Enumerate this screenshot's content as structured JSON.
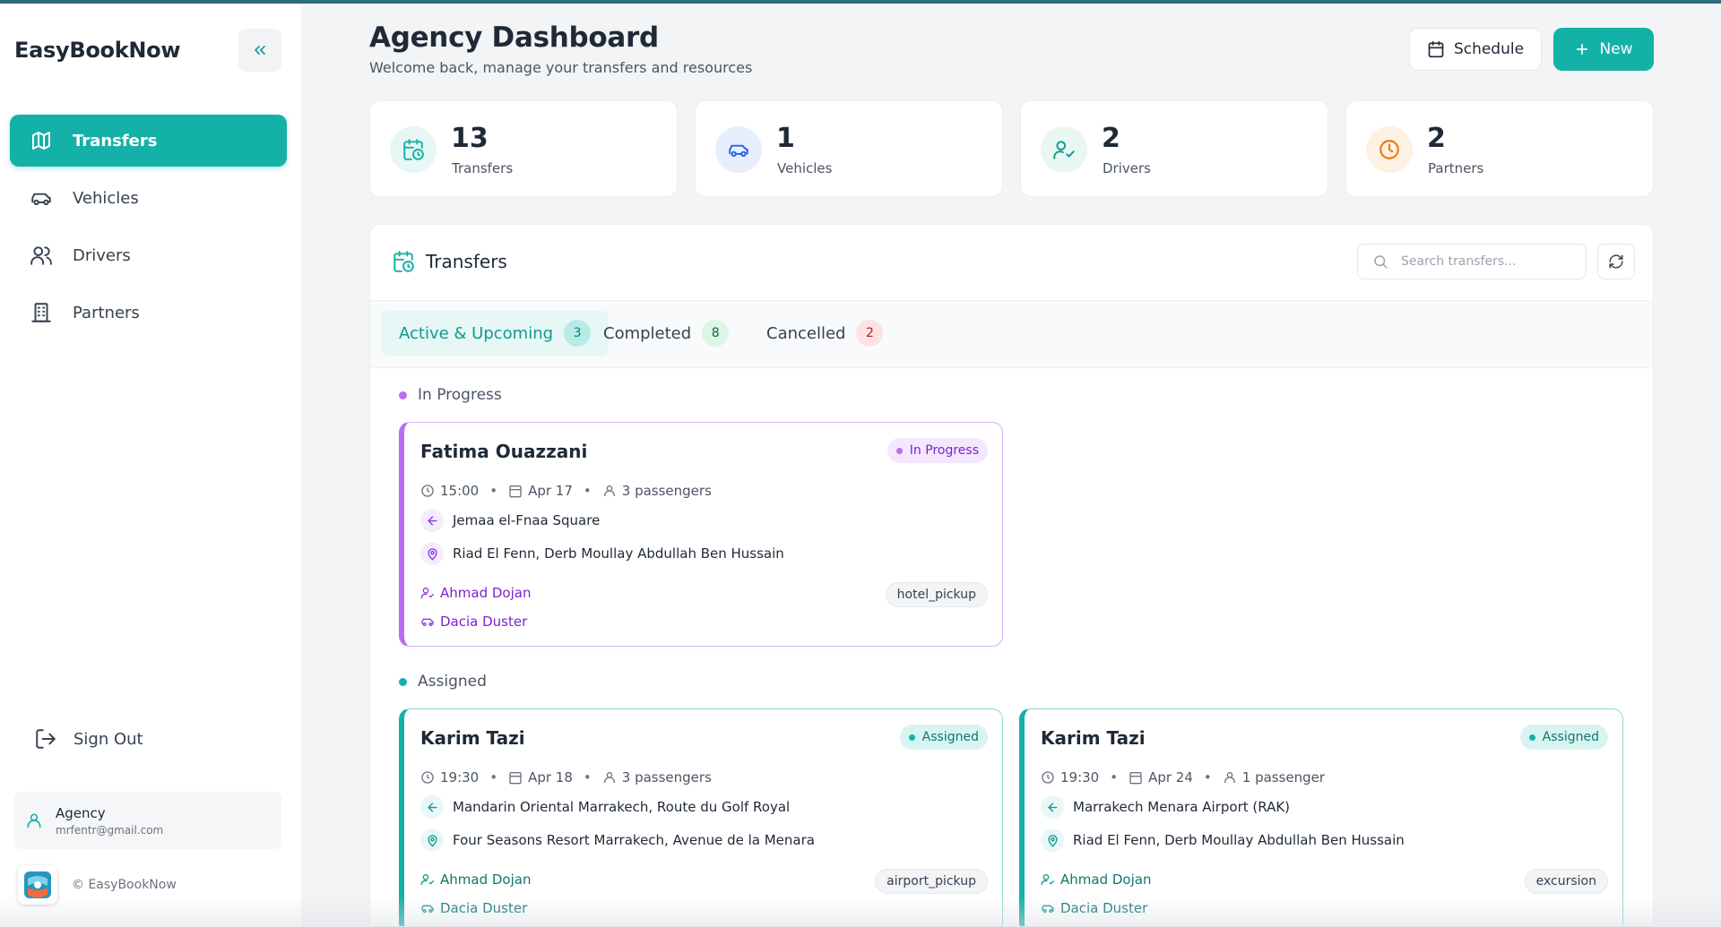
{
  "app": {
    "brand": "EasyBookNow"
  },
  "colors": {
    "accent": "#14b1a8",
    "purple": "#9333ea",
    "teal_border": "#5ccfc6",
    "purple_border": "#c98df5",
    "danger": "#dc2626"
  },
  "sidebar": {
    "items": [
      {
        "label": "Transfers",
        "icon": "map-icon",
        "active": true
      },
      {
        "label": "Vehicles",
        "icon": "car-icon",
        "active": false
      },
      {
        "label": "Drivers",
        "icon": "users-icon",
        "active": false
      },
      {
        "label": "Partners",
        "icon": "building-icon",
        "active": false
      }
    ],
    "sign_out": "Sign Out",
    "user": {
      "name": "Agency",
      "email": "mrfentr@gmail.com"
    },
    "copyright": "© EasyBookNow"
  },
  "header": {
    "title": "Agency Dashboard",
    "subtitle": "Welcome back, manage your transfers and resources",
    "schedule_label": "Schedule",
    "new_label": "New"
  },
  "stats": [
    {
      "value": "13",
      "label": "Transfers",
      "icon": "calendar-clock-icon"
    },
    {
      "value": "1",
      "label": "Vehicles",
      "icon": "car-icon"
    },
    {
      "value": "2",
      "label": "Drivers",
      "icon": "user-check-icon"
    },
    {
      "value": "2",
      "label": "Partners",
      "icon": "clock-icon"
    }
  ],
  "panel": {
    "title": "Transfers",
    "search_placeholder": "Search transfers...",
    "tabs": [
      {
        "label": "Active & Upcoming",
        "count": "3"
      },
      {
        "label": "Completed",
        "count": "8"
      },
      {
        "label": "Cancelled",
        "count": "2"
      }
    ],
    "sections": [
      {
        "label": "In Progress"
      },
      {
        "label": "Assigned"
      }
    ],
    "cards": [
      {
        "name": "Fatima Ouazzani",
        "status": "In Progress",
        "time": "15:00",
        "date": "Apr 17",
        "passengers": "3 passengers",
        "from": "Jemaa el-Fnaa Square",
        "to": "Riad El Fenn, Derb Moullay Abdullah Ben Hussain",
        "driver": "Ahmad Dojan",
        "vehicle": "Dacia Duster",
        "type": "hotel_pickup"
      },
      {
        "name": "Karim Tazi",
        "status": "Assigned",
        "time": "19:30",
        "date": "Apr 18",
        "passengers": "3 passengers",
        "from": "Mandarin Oriental Marrakech, Route du Golf Royal",
        "to": "Four Seasons Resort Marrakech, Avenue de la Menara",
        "driver": "Ahmad Dojan",
        "vehicle": "Dacia Duster",
        "type": "airport_pickup"
      },
      {
        "name": "Karim Tazi",
        "status": "Assigned",
        "time": "19:30",
        "date": "Apr 24",
        "passengers": "1 passenger",
        "from": "Marrakech Menara Airport (RAK)",
        "to": "Riad El Fenn, Derb Moullay Abdullah Ben Hussain",
        "driver": "Ahmad Dojan",
        "vehicle": "Dacia Duster",
        "type": "excursion"
      }
    ]
  }
}
